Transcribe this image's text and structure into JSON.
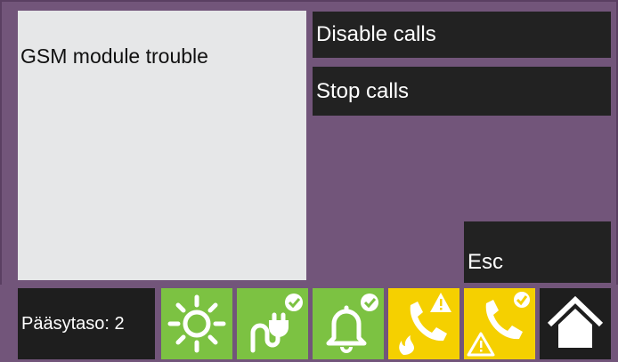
{
  "message": {
    "text": "GSM module trouble"
  },
  "menu": {
    "disable_calls": "Disable calls",
    "stop_calls": "Stop calls",
    "esc": "Esc"
  },
  "status": {
    "access_level": "Pääsytaso: 2"
  },
  "colors": {
    "background": "#72557a",
    "panel": "#e6e7e8",
    "button": "#222222",
    "tile_green": "#7cc242",
    "tile_yellow": "#f5d000"
  },
  "icons": [
    "sun-icon",
    "power-plug-icon",
    "bell-icon",
    "phone-fire-alarm-icon",
    "phone-warning-icon",
    "home-icon"
  ]
}
